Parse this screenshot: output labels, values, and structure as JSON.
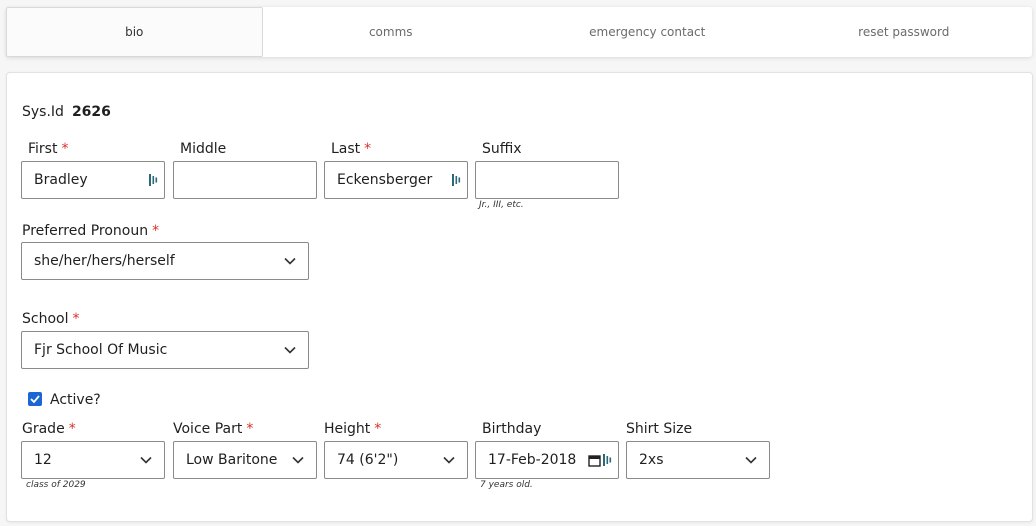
{
  "tabs": [
    {
      "label": "bio",
      "active": true
    },
    {
      "label": "comms",
      "active": false
    },
    {
      "label": "emergency contact",
      "active": false
    },
    {
      "label": "reset password",
      "active": false
    }
  ],
  "sys": {
    "label": "Sys.Id",
    "value": "2626"
  },
  "required_mark": "*",
  "name": {
    "first": {
      "label": "First",
      "value": "Bradley",
      "required": true
    },
    "middle": {
      "label": "Middle",
      "value": "",
      "required": false
    },
    "last": {
      "label": "Last",
      "value": "Eckensberger",
      "required": true
    },
    "suffix": {
      "label": "Suffix",
      "value": "",
      "hint": "Jr., III, etc.",
      "required": false
    }
  },
  "pronoun": {
    "label": "Preferred Pronoun",
    "value": "she/her/hers/herself",
    "required": true
  },
  "school": {
    "label": "School",
    "value": "Fjr School Of Music",
    "required": true
  },
  "active": {
    "label": "Active?",
    "checked": true
  },
  "grade": {
    "label": "Grade",
    "value": "12",
    "hint": "class of 2029",
    "required": true
  },
  "voice_part": {
    "label": "Voice Part",
    "value": "Low Baritone",
    "required": true
  },
  "height": {
    "label": "Height",
    "value": "74 (6'2\")",
    "required": true
  },
  "birthday": {
    "label": "Birthday",
    "value": "17-Feb-2018",
    "hint": "7 years old.",
    "required": false
  },
  "shirt_size": {
    "label": "Shirt Size",
    "value": "2xs",
    "required": false
  },
  "colors": {
    "accent": "#1a66d2",
    "required": "#d9302b",
    "password_manager_icon": "#2a6a78"
  },
  "icons": {
    "dropdown": "chevron-down-icon",
    "password_manager": "lastpass-icon",
    "calendar": "calendar-icon",
    "checkbox": "checkmark-icon"
  }
}
